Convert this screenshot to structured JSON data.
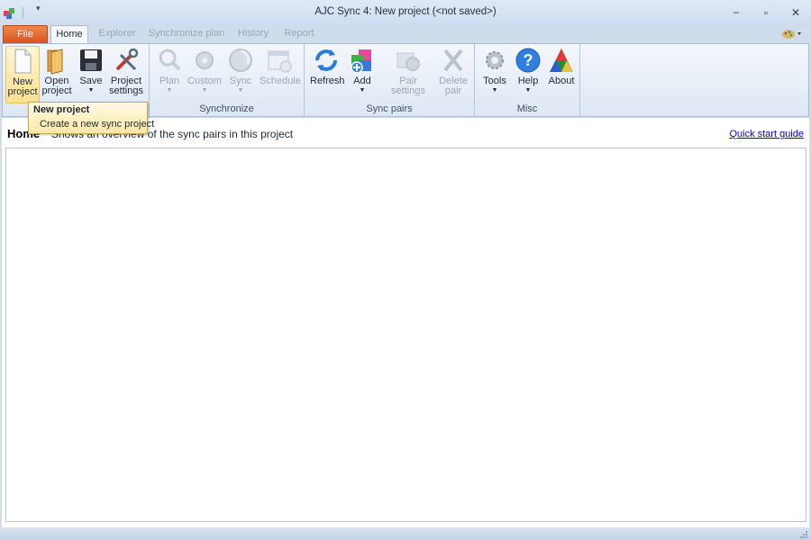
{
  "window": {
    "title": "AJC Sync 4:  New project (<not saved>)",
    "controls": {
      "minimize": "−",
      "maximize": "▫",
      "close": "✕"
    }
  },
  "quick_access": {
    "dropdown": "▾"
  },
  "tabs": [
    {
      "label": "File"
    },
    {
      "label": "Home"
    },
    {
      "label": "Explorer"
    },
    {
      "label": "Synchronize plan"
    },
    {
      "label": "History"
    },
    {
      "label": "Report"
    }
  ],
  "ribbon": {
    "groups": {
      "project": {
        "buttons": [
          {
            "label": "New\nproject",
            "icon": "new-document-icon"
          },
          {
            "label": "Open\nproject",
            "icon": "open-folder-icon"
          },
          {
            "label": "Save",
            "icon": "save-disk-icon",
            "arrow": "▼"
          },
          {
            "label": "Project\nsettings",
            "icon": "tools-icon"
          }
        ]
      },
      "synchronize": {
        "label": "Synchronize",
        "buttons": [
          {
            "label": "Plan",
            "icon": "plan-icon",
            "arrow": "▼"
          },
          {
            "label": "Custom",
            "icon": "custom-gear-icon",
            "arrow": "▼"
          },
          {
            "label": "Sync",
            "icon": "sync-icon",
            "arrow": "▼"
          },
          {
            "label": "Schedule",
            "icon": "schedule-icon"
          }
        ]
      },
      "sync_pairs": {
        "label": "Sync pairs",
        "buttons": [
          {
            "label": "Refresh",
            "icon": "refresh-icon"
          },
          {
            "label": "Add",
            "icon": "add-icon",
            "arrow": "▼"
          },
          {
            "label": "Pair settings",
            "icon": "pair-settings-icon"
          },
          {
            "label": "Delete\npair",
            "icon": "delete-icon"
          }
        ]
      },
      "misc": {
        "label": "Misc",
        "buttons": [
          {
            "label": "Tools",
            "icon": "tools-gear-icon",
            "arrow": "▼"
          },
          {
            "label": "Help",
            "icon": "help-icon",
            "arrow": "▼"
          },
          {
            "label": "About",
            "icon": "about-icon"
          }
        ]
      }
    }
  },
  "tooltip": {
    "title": "New project",
    "description": "Create a new sync project"
  },
  "content": {
    "heading": "Home",
    "description": "Shows an overview of the sync pairs in this project",
    "quick_start_link": "Quick start guide"
  }
}
